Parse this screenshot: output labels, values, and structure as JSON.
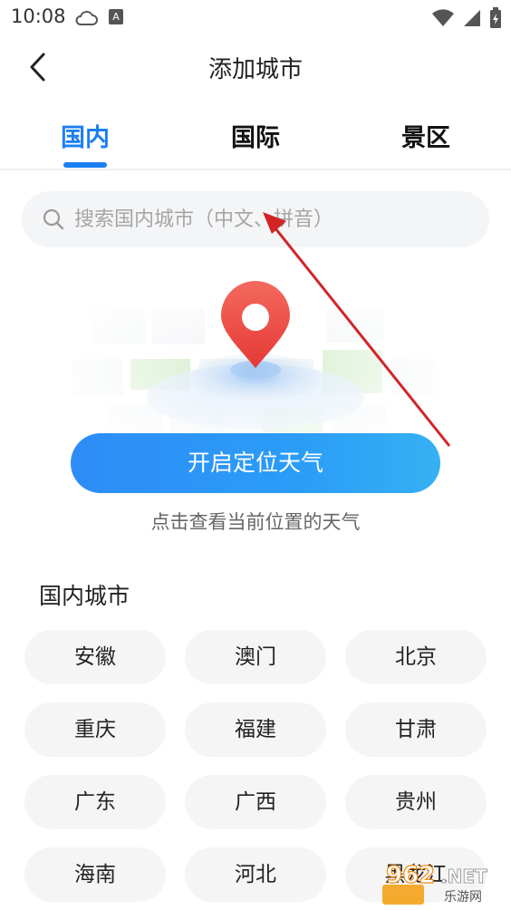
{
  "status_bar": {
    "time": "10:08",
    "a_badge": "A"
  },
  "header": {
    "title": "添加城市"
  },
  "tabs": [
    {
      "label": "国内",
      "active": true
    },
    {
      "label": "国际",
      "active": false
    },
    {
      "label": "景区",
      "active": false
    }
  ],
  "search": {
    "placeholder": "搜索国内城市（中文、拼音）"
  },
  "locate": {
    "button_label": "开启定位天气",
    "hint": "点击查看当前位置的天气"
  },
  "section": {
    "title": "国内城市",
    "cities": [
      "安徽",
      "澳门",
      "北京",
      "重庆",
      "福建",
      "甘肃",
      "广东",
      "广西",
      "贵州",
      "海南",
      "河北",
      "黑龙江"
    ]
  },
  "watermark": {
    "main": "962.NET",
    "sub": "乐游网"
  },
  "colors": {
    "accent": "#1a7ff2",
    "button_start": "#2d8cf7",
    "button_end": "#36b0f4",
    "pin": "#f2504a",
    "annotation": "#d32424"
  }
}
